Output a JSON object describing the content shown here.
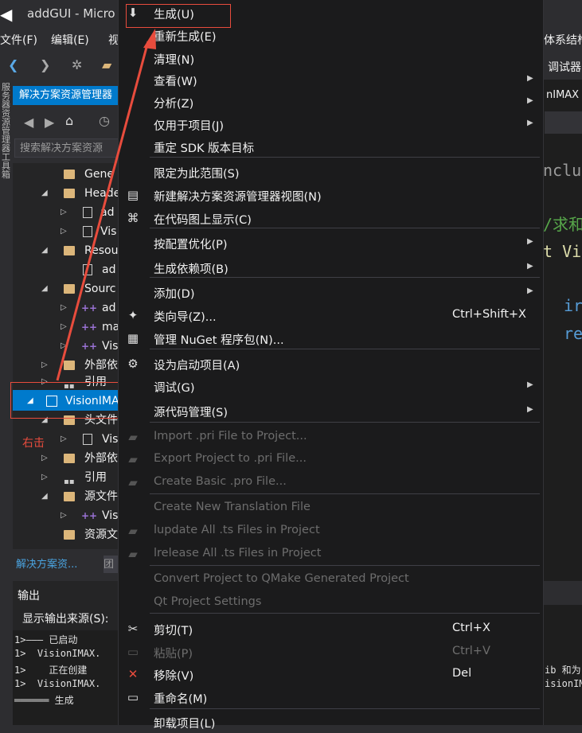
{
  "window": {
    "title": "addGUI - Micro"
  },
  "menubar": {
    "file": "文件(F)",
    "edit": "编辑(E)",
    "view": "视",
    "arch": "体系结构",
    "debugger": "调试器"
  },
  "solution_explorer": {
    "header": "解决方案资源管理器",
    "search_placeholder": "搜索解决方案资源",
    "tree": [
      {
        "label": "Gene"
      },
      {
        "label": "Heade"
      },
      {
        "label": "ad"
      },
      {
        "label": "Vis"
      },
      {
        "label": "Resou"
      },
      {
        "label": "ad"
      },
      {
        "label": "Sourc"
      },
      {
        "label": "ad"
      },
      {
        "label": "ma"
      },
      {
        "label": "Vis"
      },
      {
        "label": "外部依"
      },
      {
        "label": "引用"
      },
      {
        "label": "VisionIMA"
      },
      {
        "label": "头文件"
      },
      {
        "label": "Vis"
      },
      {
        "label": "外部依"
      },
      {
        "label": "引用"
      },
      {
        "label": "源文件"
      },
      {
        "label": "Vis"
      },
      {
        "label": "资源文"
      }
    ],
    "bottom_tab_active": "解决方案资...",
    "bottom_tab_2": "团"
  },
  "left_strip_text": "服务器资源管理器 工具箱",
  "annotation": {
    "right_click": "右击"
  },
  "output": {
    "title": "输出",
    "source_label": "显示输出来源(S):",
    "lines": [
      "1>——— 已启动",
      "1>  VisionIMAX.",
      "1>    正在创建",
      "1>  VisionIMAX.",
      "══════ 生成"
    ],
    "right_lines": [
      "ib 和为",
      "isionIMA"
    ]
  },
  "editor": {
    "tab": "nIMAX",
    "code_lines": [
      "nclu",
      "/求和",
      "t Vi",
      "ir",
      "re"
    ]
  },
  "context_menu": {
    "items": [
      {
        "icon": "build-icon",
        "glyph": "⬇",
        "label": "生成(U)"
      },
      {
        "label": "重新生成(E)"
      },
      {
        "label": "清理(N)"
      },
      {
        "label": "查看(W)",
        "submenu": true
      },
      {
        "label": "分析(Z)",
        "submenu": true
      },
      {
        "label": "仅用于项目(J)",
        "submenu": true
      },
      {
        "label": "重定 SDK 版本目标"
      },
      {
        "label": "限定为此范围(S)"
      },
      {
        "icon": "new-view-icon",
        "glyph": "▤",
        "label": "新建解决方案资源管理器视图(N)"
      },
      {
        "icon": "code-map-icon",
        "glyph": "⌘",
        "label": "在代码图上显示(C)"
      },
      {
        "label": "按配置优化(P)",
        "submenu": true
      },
      {
        "label": "生成依赖项(B)",
        "submenu": true
      },
      {
        "label": "添加(D)",
        "submenu": true
      },
      {
        "icon": "class-wizard-icon",
        "glyph": "✦",
        "label": "类向导(Z)...",
        "shortcut": "Ctrl+Shift+X"
      },
      {
        "icon": "nuget-icon",
        "glyph": "▦",
        "label": "管理 NuGet 程序包(N)..."
      },
      {
        "icon": "gear-icon",
        "glyph": "⚙",
        "label": "设为启动项目(A)"
      },
      {
        "label": "调试(G)",
        "submenu": true
      },
      {
        "label": "源代码管理(S)",
        "submenu": true
      },
      {
        "icon": "qt-import-icon",
        "glyph": "▰",
        "label": "Import .pri File to Project...",
        "disabled": true
      },
      {
        "icon": "qt-export-icon",
        "glyph": "▰",
        "label": "Export Project to .pri File...",
        "disabled": true
      },
      {
        "icon": "qt-pro-icon",
        "glyph": "▰",
        "label": "Create Basic .pro File...",
        "disabled": true
      },
      {
        "label": "Create New Translation File",
        "disabled": true
      },
      {
        "icon": "lupdate-icon",
        "glyph": "▰",
        "label": "lupdate All .ts Files in Project",
        "disabled": true
      },
      {
        "icon": "lrelease-icon",
        "glyph": "▰",
        "label": "lrelease All .ts Files in Project",
        "disabled": true
      },
      {
        "label": "Convert Project to QMake Generated Project",
        "disabled": true
      },
      {
        "label": "Qt Project Settings",
        "disabled": true
      },
      {
        "icon": "cut-icon",
        "glyph": "✂",
        "label": "剪切(T)",
        "shortcut": "Ctrl+X"
      },
      {
        "icon": "paste-icon",
        "glyph": "▭",
        "label": "粘贴(P)",
        "shortcut": "Ctrl+V",
        "disabled": true
      },
      {
        "icon": "remove-icon",
        "glyph": "✕",
        "label": "移除(V)",
        "shortcut": "Del"
      },
      {
        "icon": "rename-icon",
        "glyph": "▭",
        "label": "重命名(M)"
      },
      {
        "label": "卸载项目(L)"
      }
    ]
  },
  "colors": {
    "accent": "#007acc",
    "annotation_red": "#e84c3d",
    "menu_bg": "#1b1b1c",
    "ide_bg": "#2d2d30"
  }
}
